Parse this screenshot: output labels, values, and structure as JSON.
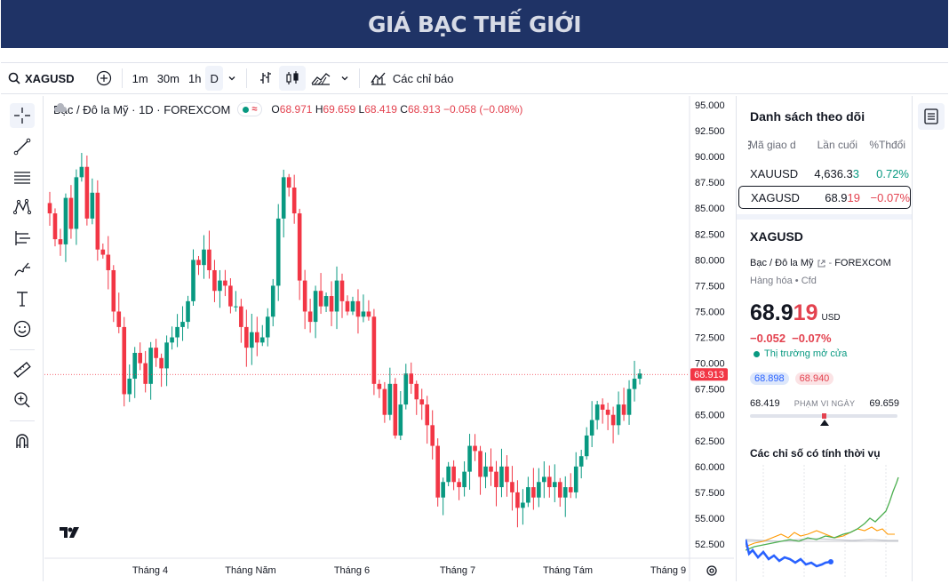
{
  "banner": {
    "title": "GIÁ BẠC THẾ GIỚI"
  },
  "toolbar": {
    "symbol": "XAGUSD",
    "intervals": [
      "1m",
      "30m",
      "1h",
      "D"
    ],
    "active_interval": "D",
    "indicators_label": "Các chỉ báo"
  },
  "legend": {
    "title": "Bạc / Đô la Mỹ · 1D · FOREXCOM",
    "open_label": "O",
    "open": "68.971",
    "high_label": "H",
    "high": "69.659",
    "low_label": "L",
    "low": "68.419",
    "close_label": "C",
    "close": "68.913",
    "change": "−0.058 (−0.08%)"
  },
  "chart_data": {
    "type": "candlestick",
    "x_labels": [
      "Tháng 4",
      "Tháng Năm",
      "Tháng 6",
      "Tháng 7",
      "Tháng Tám",
      "Tháng 9"
    ],
    "y_ticks": [
      "95.000",
      "92.500",
      "90.000",
      "87.500",
      "85.000",
      "82.500",
      "80.000",
      "77.500",
      "75.000",
      "72.500",
      "70.000",
      "67.500",
      "65.000",
      "62.500",
      "60.000",
      "57.500",
      "55.000",
      "52.500"
    ],
    "ylim": [
      52.5,
      95.0
    ],
    "last_price": "68.913",
    "last_price_value": 68.913,
    "up_color": "#089981",
    "down_color": "#f23645",
    "closes": [
      84.5,
      82.0,
      81.5,
      86.0,
      83.0,
      88.0,
      89.0,
      84.0,
      86.5,
      81.0,
      80.5,
      79.0,
      75.0,
      73.5,
      67.0,
      68.5,
      71.0,
      70.0,
      68.0,
      71.5,
      70.5,
      69.5,
      72.0,
      72.5,
      73.5,
      74.0,
      76.0,
      80.0,
      79.5,
      81.0,
      79.0,
      77.0,
      78.0,
      77.5,
      75.5,
      75.5,
      73.5,
      71.5,
      73.0,
      72.0,
      72.5,
      74.5,
      77.5,
      84.0,
      88.0,
      87.0,
      84.5,
      78.0,
      75.0,
      74.0,
      77.0,
      75.5,
      76.5,
      75.0,
      78.0,
      76.0,
      75.0,
      76.0,
      74.5,
      75.0,
      74.5,
      68.0,
      67.5,
      65.0,
      68.0,
      63.0,
      66.0,
      69.0,
      68.0,
      66.5,
      66.0,
      64.0,
      62.0,
      57.0,
      58.5,
      60.0,
      58.5,
      58.0,
      59.5,
      62.0,
      61.5,
      59.0,
      60.0,
      59.5,
      58.0,
      60.0,
      58.5,
      57.5,
      56.0,
      56.5,
      58.0,
      57.0,
      58.5,
      59.0,
      58.0,
      58.5,
      57.0,
      58.0,
      57.5,
      60.0,
      61.0,
      63.0,
      64.5,
      66.0,
      65.5,
      65.0,
      64.0,
      66.0,
      65.0,
      67.5,
      68.5,
      69.0
    ],
    "seasonal": {
      "title": "Các chỉ số có tính thời vụ",
      "series_colors": [
        "#4caf50",
        "#ff9800",
        "#2962ff",
        "#c7c9d0"
      ]
    }
  },
  "watchlist": {
    "title": "Danh sách theo dõi",
    "headers": [
      "Mã giao d",
      "Lần cuối",
      "%Thđổi"
    ],
    "rows": [
      {
        "symbol": "XAUUSD",
        "last_main": "4,636.3",
        "last_tail": "3",
        "change": "0.72%",
        "dir": "up"
      },
      {
        "symbol": "XAGUSD",
        "last_main": "68.9",
        "last_tail": "19",
        "change": "−0.07%",
        "dir": "down"
      }
    ]
  },
  "details": {
    "symbol": "XAGUSD",
    "name": "Bạc / Đô la Mỹ",
    "exchange": "FOREXCOM",
    "category": "Hàng hóa",
    "type": "Cfd",
    "price_main": "68.9",
    "price_tail": "19",
    "currency": "USD",
    "change_abs": "−0.052",
    "change_pct": "−0.07%",
    "market_status": "Thị trường mở cửa",
    "bid": "68.898",
    "ask": "68.940",
    "day_low": "68.419",
    "day_high": "69.659",
    "range_label": "PHẠM VI NGÀY",
    "day_range_position": 0.5
  }
}
